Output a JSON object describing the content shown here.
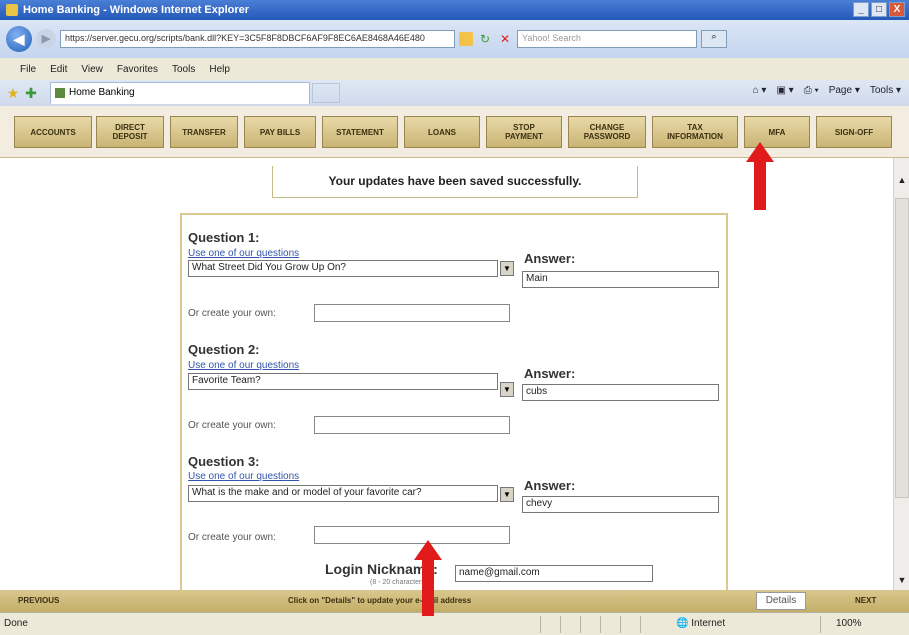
{
  "window": {
    "title": "Home Banking - Windows Internet Explorer",
    "controls": [
      "_",
      "□",
      "X"
    ]
  },
  "address": {
    "url": "https://server.gecu.org/scripts/bank.dll?KEY=3C5F8F8DBCF6AF9F8EC6AE8468A46E480",
    "search_placeholder": "Yahoo! Search"
  },
  "menu": [
    "File",
    "Edit",
    "View",
    "Favorites",
    "Tools",
    "Help"
  ],
  "tab": {
    "label": "Home Banking"
  },
  "commands": [
    "Page ▾",
    "Tools ▾"
  ],
  "bank_nav": [
    "ACCOUNTS",
    "DIRECT\nDEPOSIT",
    "TRANSFER",
    "PAY BILLS",
    "STATEMENT",
    "LOANS",
    "STOP\nPAYMENT",
    "CHANGE\nPASSWORD",
    "TAX\nINFORMATION",
    "MFA",
    "SIGN-OFF"
  ],
  "success_message": "Your updates have been saved successfully.",
  "questions": [
    {
      "title": "Question 1:",
      "use_link": "Use one of our questions",
      "selected": "What Street Did You Grow Up On?",
      "answer_label": "Answer:",
      "answer": "Main",
      "own_label": "Or create your own:"
    },
    {
      "title": "Question 2:",
      "use_link": "Use one of our questions",
      "selected": "Favorite Team?",
      "answer_label": "Answer:",
      "answer": "cubs",
      "own_label": "Or create your own:"
    },
    {
      "title": "Question 3:",
      "use_link": "Use one of our questions",
      "selected": "What is the make and or model of your favorite car?",
      "answer_label": "Answer:",
      "answer": "chevy",
      "own_label": "Or create your own:"
    }
  ],
  "nickname": {
    "label": "Login Nickname:",
    "sub": "(8 - 20 characters)",
    "value": "name@gmail.com"
  },
  "footer": {
    "previous": "PREVIOUS",
    "message": "Click on \"Details\" to update your e-mail address",
    "details": "Details",
    "next": "NEXT"
  },
  "status": {
    "left": "Done",
    "zone": "Internet",
    "zoom": "100%"
  }
}
